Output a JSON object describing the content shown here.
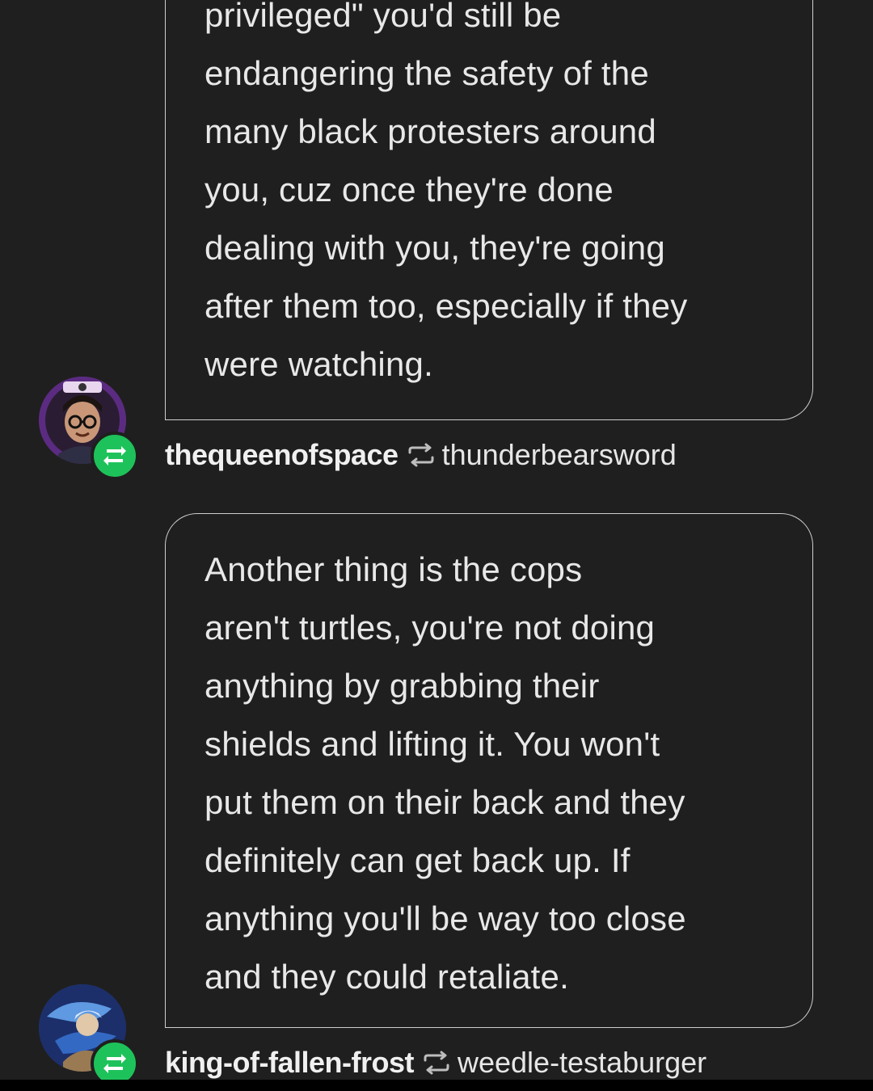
{
  "posts": [
    {
      "text": "privileged\" you'd still be\nendangering the safety of the\nmany black protesters around\nyou, cuz once they're done\ndealing with you, they're going\nafter them too, especially if they\nwere watching.",
      "user": "thequeenofspace",
      "reblogged_from": "thunderbearsword",
      "avatar_icon": "avatar-thequeenofspace",
      "badge_icon": "reblog-icon"
    },
    {
      "text": "Another thing is the cops\naren't turtles, you're not doing\nanything by grabbing their\nshields and lifting it. You won't\nput them on their back and they\ndefinitely can get back up. If\nanything you'll be way too close\nand they could retaliate.",
      "user": "king-of-fallen-frost",
      "reblogged_from": "weedle-testaburger",
      "avatar_icon": "avatar-king-of-fallen-frost",
      "badge_icon": "reblog-icon"
    }
  ],
  "colors": {
    "background": "#1f1f1f",
    "bubble_border": "#cfcfcf",
    "reblog_badge": "#1ec25a",
    "text": "#e8e8e8"
  }
}
